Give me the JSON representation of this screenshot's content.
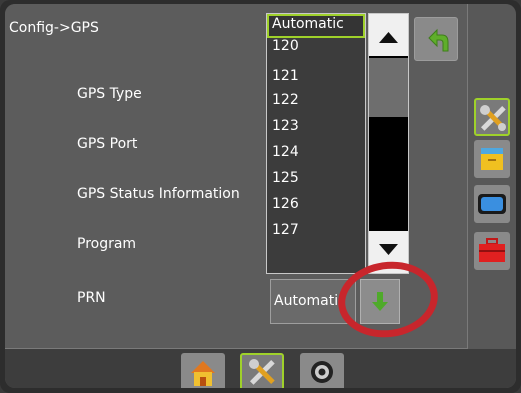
{
  "header": {
    "breadcrumb": "Config->GPS"
  },
  "settings": {
    "labels": [
      "GPS Type",
      "GPS Port",
      "GPS Status Information",
      "Program",
      "PRN"
    ]
  },
  "dropdown": {
    "options": [
      "Automatic",
      "120",
      "121",
      "122",
      "123",
      "124",
      "125",
      "126",
      "127"
    ],
    "selected": "Automatic"
  },
  "prn": {
    "value": "Automatic"
  },
  "colors": {
    "accent": "#9fd12a",
    "annotation": "#c8262c",
    "back_arrow": "#5fae2b"
  },
  "icons": {
    "back": "back-arrow-icon",
    "side": [
      "tools-icon",
      "data-cabinet-icon",
      "console-display-icon",
      "toolbox-icon"
    ],
    "bottom": [
      "home-icon",
      "tools-icon",
      "camera-icon"
    ]
  }
}
